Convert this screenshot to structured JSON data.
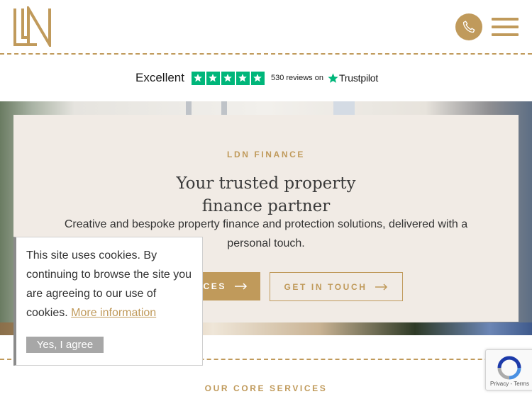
{
  "header": {
    "logo_alt": "LDN",
    "phone_icon": "phone-icon",
    "menu_icon": "hamburger-menu-icon"
  },
  "trustpilot": {
    "rating_label": "Excellent",
    "stars": 5,
    "reviews_text": "530 reviews on",
    "brand": "Trustpilot",
    "star_color": "#00b67a"
  },
  "hero": {
    "eyebrow": "LDN FINANCE",
    "title_line1": "Your trusted property",
    "title_line2": "finance partner",
    "description": "Creative and bespoke property finance and protection solutions, delivered with a personal touch.",
    "primary_button_label": "ICES",
    "secondary_button_label": "GET IN TOUCH"
  },
  "cookie_banner": {
    "text": "This site uses cookies. By continuing to browse the site you are agreeing to our use of cookies.",
    "more_link": "More information",
    "agree_button": "Yes, I agree"
  },
  "services": {
    "section_label": "OUR CORE SERVICES"
  },
  "recaptcha": {
    "links": "Privacy - Terms"
  },
  "colors": {
    "accent": "#c09a5b",
    "card_bg": "#f1ebe5",
    "trustpilot_green": "#00b67a"
  }
}
